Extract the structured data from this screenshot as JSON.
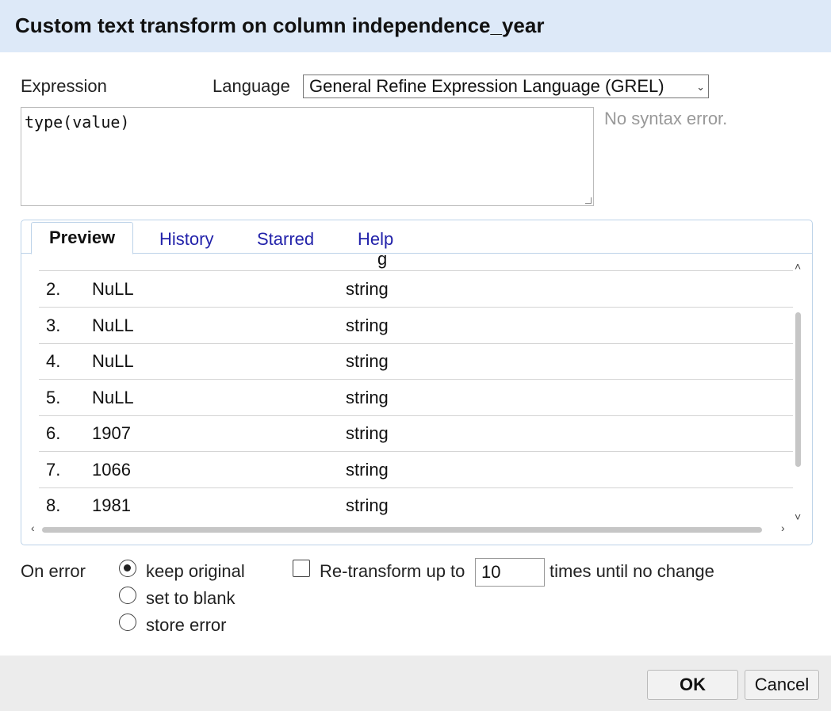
{
  "dialog": {
    "title": "Custom text transform on column independence_year"
  },
  "expression": {
    "label": "Expression",
    "language_label": "Language",
    "language_value": "General Refine Expression Language (GREL)",
    "code": "type(value)",
    "status": "No syntax error."
  },
  "tabs": [
    {
      "label": "Preview",
      "active": true
    },
    {
      "label": "History",
      "active": false
    },
    {
      "label": "Starred",
      "active": false
    },
    {
      "label": "Help",
      "active": false
    }
  ],
  "preview": {
    "partial_result": "g",
    "rows": [
      {
        "index": "2.",
        "value": "NuLL",
        "result": "string"
      },
      {
        "index": "3.",
        "value": "NuLL",
        "result": "string"
      },
      {
        "index": "4.",
        "value": "NuLL",
        "result": "string"
      },
      {
        "index": "5.",
        "value": "NuLL",
        "result": "string"
      },
      {
        "index": "6.",
        "value": "1907",
        "result": "string"
      },
      {
        "index": "7.",
        "value": "1066",
        "result": "string"
      },
      {
        "index": "8.",
        "value": "1981",
        "result": "string"
      }
    ]
  },
  "on_error": {
    "label": "On error",
    "options": [
      {
        "label": "keep original",
        "selected": true
      },
      {
        "label": "set to blank",
        "selected": false
      },
      {
        "label": "store error",
        "selected": false
      }
    ]
  },
  "retransform": {
    "checked": false,
    "label_before": "Re-transform up to",
    "times_value": "10",
    "label_after": "times until no change"
  },
  "buttons": {
    "ok": "OK",
    "cancel": "Cancel"
  }
}
